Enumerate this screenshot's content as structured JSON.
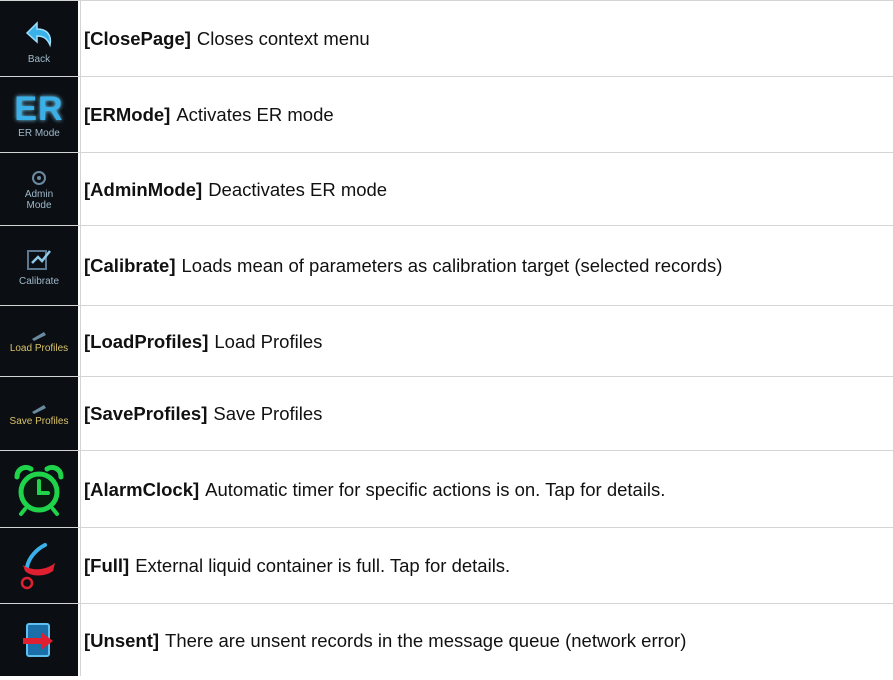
{
  "rows": [
    {
      "code": "[ClosePage]",
      "desc": "Closes context menu",
      "icon_label": "Back",
      "icon": "back-arrow-icon"
    },
    {
      "code": "[ERMode]",
      "desc": "Activates ER mode",
      "icon_label": "ER Mode",
      "icon_glyph": "ER",
      "icon": "er-mode-icon"
    },
    {
      "code": "[AdminMode]",
      "desc": "Deactivates ER mode",
      "icon_label": "Admin Mode",
      "icon": "admin-mode-icon"
    },
    {
      "code": "[Calibrate]",
      "desc": "Loads mean of parameters as calibration target (selected records)",
      "icon_label": "Calibrate",
      "icon": "calibrate-icon"
    },
    {
      "code": "[LoadProfiles]",
      "desc": "Load Profiles",
      "icon_label": "Load Profiles",
      "icon": "load-profiles-icon"
    },
    {
      "code": "[SaveProfiles]",
      "desc": "Save Profiles",
      "icon_label": "Save Profiles",
      "icon": "save-profiles-icon"
    },
    {
      "code": "[AlarmClock]",
      "desc": "Automatic timer for specific actions is on. Tap for details.",
      "icon": "alarm-clock-icon"
    },
    {
      "code": "[Full]",
      "desc": "External liquid container is full. Tap for details.",
      "icon": "full-container-icon"
    },
    {
      "code": "[Unsent]",
      "desc": "There are unsent records in the message queue (network error)",
      "icon": "unsent-records-icon"
    }
  ],
  "colors": {
    "border": "#d4d4d4",
    "icon_bg": "#0b0f14",
    "accent_blue": "#3ab0e8",
    "alarm_green": "#1fd34a",
    "alert_red": "#e02030"
  }
}
